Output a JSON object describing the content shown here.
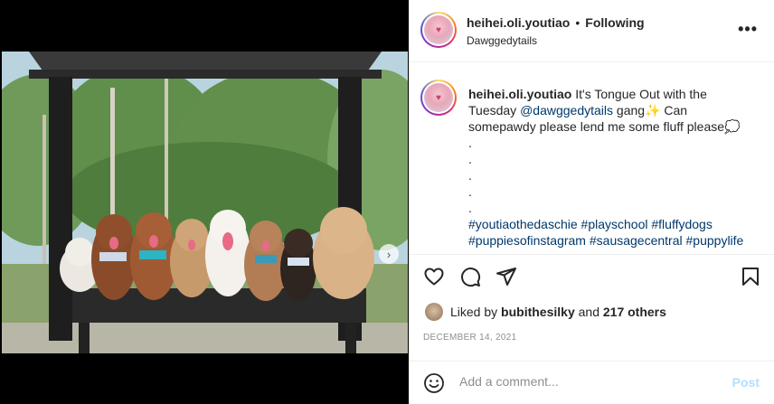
{
  "post": {
    "author": "heihei.oli.youtiao",
    "separator": "•",
    "follow_status": "Following",
    "location": "Dawggedytails",
    "more_icon": "more-horizontal-icon",
    "caption": {
      "author": "heihei.oli.youtiao",
      "text_1": "It's Tongue Out with the Tuesday",
      "mention": "@dawggedytails",
      "text_2": "gang",
      "text_3": "Can somepawdy please lend me some fluff please",
      "dots": [
        ".",
        ".",
        ".",
        ".",
        "."
      ],
      "hashtags": [
        "#youtiaothedaschie",
        "#playschool",
        "#fluffydogs",
        "#puppiesofinstagram",
        "#sausagecentral",
        "#puppylife"
      ]
    },
    "liked_by_prefix": "Liked by",
    "liked_by_user": "bubithesilky",
    "liked_by_and": "and",
    "liked_by_others": "217 others",
    "date": "DECEMBER 14, 2021",
    "comment_placeholder": "Add a comment...",
    "post_label": "Post"
  },
  "icons": {
    "like": "heart-icon",
    "comment": "comment-bubble-icon",
    "share": "paper-plane-icon",
    "save": "bookmark-icon",
    "emoji": "smiley-icon",
    "next": "chevron-right-icon",
    "tag": "user-tag-icon"
  },
  "colors": {
    "link": "#00376b",
    "post_disabled": "#b2dffc",
    "meta_gray": "#8e8e8e"
  }
}
